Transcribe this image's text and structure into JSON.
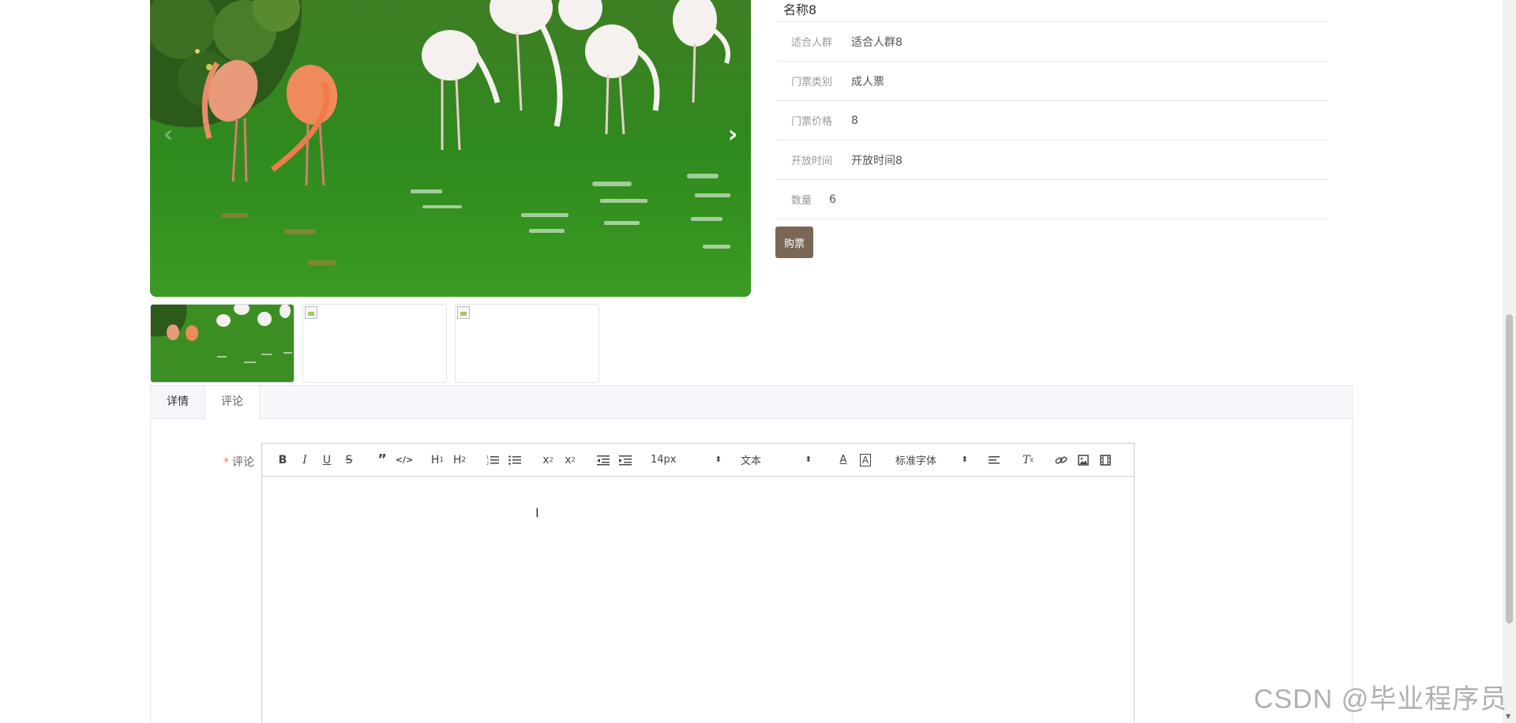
{
  "detail": {
    "name": "名称8",
    "fields": [
      {
        "label": "适合人群",
        "value": "适合人群8"
      },
      {
        "label": "门票类别",
        "value": "成人票"
      },
      {
        "label": "门票价格",
        "value": "8"
      },
      {
        "label": "开放时间",
        "value": "开放时间8"
      }
    ],
    "quantity": {
      "label": "数量",
      "value": "6"
    },
    "buy_label": "购票"
  },
  "tabs": [
    {
      "label": "详情",
      "active": false
    },
    {
      "label": "评论",
      "active": true
    }
  ],
  "comment_form": {
    "label": "评论",
    "required_mark": "*",
    "toolbar": {
      "font_size": "14px",
      "header": "文本",
      "font_family": "标准字体"
    }
  },
  "watermark": "CSDN @毕业程序员",
  "colors": {
    "buy_button": "#7a6654",
    "tab_bar": "#f5f7fa",
    "required": "#f56c6c"
  },
  "icons": [
    "chevron-left-icon",
    "chevron-right-icon",
    "bold-icon",
    "italic-icon",
    "underline-icon",
    "strike-icon",
    "blockquote-icon",
    "code-icon",
    "h1-icon",
    "h2-icon",
    "ordered-list-icon",
    "bullet-list-icon",
    "subscript-icon",
    "superscript-icon",
    "outdent-icon",
    "indent-icon",
    "text-color-icon",
    "background-color-icon",
    "align-icon",
    "clear-format-icon",
    "link-icon",
    "image-icon",
    "video-icon"
  ]
}
